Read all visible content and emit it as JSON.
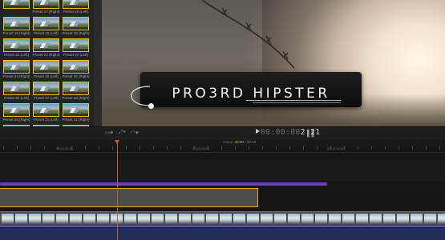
{
  "browser": {
    "clips": [
      "",
      "Preset 17 (Right)",
      "Preset 18 (Left)",
      "Preset 19 (Right)",
      "Preset 20 (Left)",
      "Preset 20 (Right)",
      "Preset 22 (Left)",
      "Preset 22 (Right)",
      "Preset 23 (Left)",
      "Preset 24 (Right)",
      "Preset 25 (Left)",
      "Preset 25 (Right)",
      "Preset 26 (Left)",
      "Preset 27 (Left)",
      "Preset 28 (Right)",
      "Preset 28 (Right)",
      "Preset 31 (Left)",
      "Preset 31 (Right)",
      "",
      "",
      ""
    ]
  },
  "viewer": {
    "title": "PRO3RD HIPSTER"
  },
  "toolbar": {
    "timecode_dim": "00:00:00",
    "timecode_value": "2:21"
  },
  "timeline": {
    "index_label": "venue",
    "index_current": "00:00",
    "index_total": "/ 00:18",
    "ruler_labels": [
      "00:00:00:00",
      "00:00:05:00",
      "00:00:10:00",
      "00:00:15:00"
    ]
  },
  "colors": {
    "accent_yellow": "#d9b52a",
    "connected_purple": "#6a3fbd",
    "playhead": "#c0613b",
    "audio_blue": "#232e5a"
  }
}
